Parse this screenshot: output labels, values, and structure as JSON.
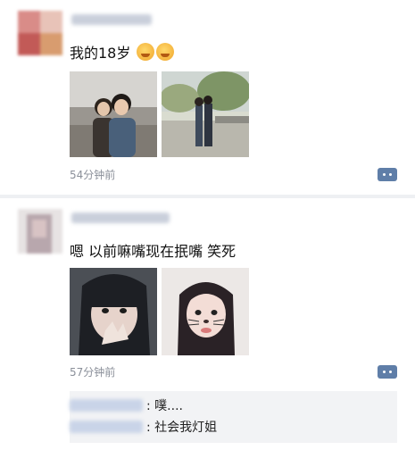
{
  "posts": [
    {
      "text": "我的18岁",
      "emoji_icons": [
        "laughing-crying-icon",
        "laughing-crying-icon"
      ],
      "time": "54分钟前"
    },
    {
      "text": "嗯 以前嘛嘴现在抿嘴 笑死",
      "time": "57分钟前",
      "comments": [
        {
          "text": ": 噗...."
        },
        {
          "text": ": 社会我灯姐"
        }
      ]
    }
  ],
  "colors": {
    "accent": "#5f7ea8",
    "time_text": "#8a8f99",
    "comment_bg": "#f2f3f5",
    "divider": "#eef0f3"
  }
}
